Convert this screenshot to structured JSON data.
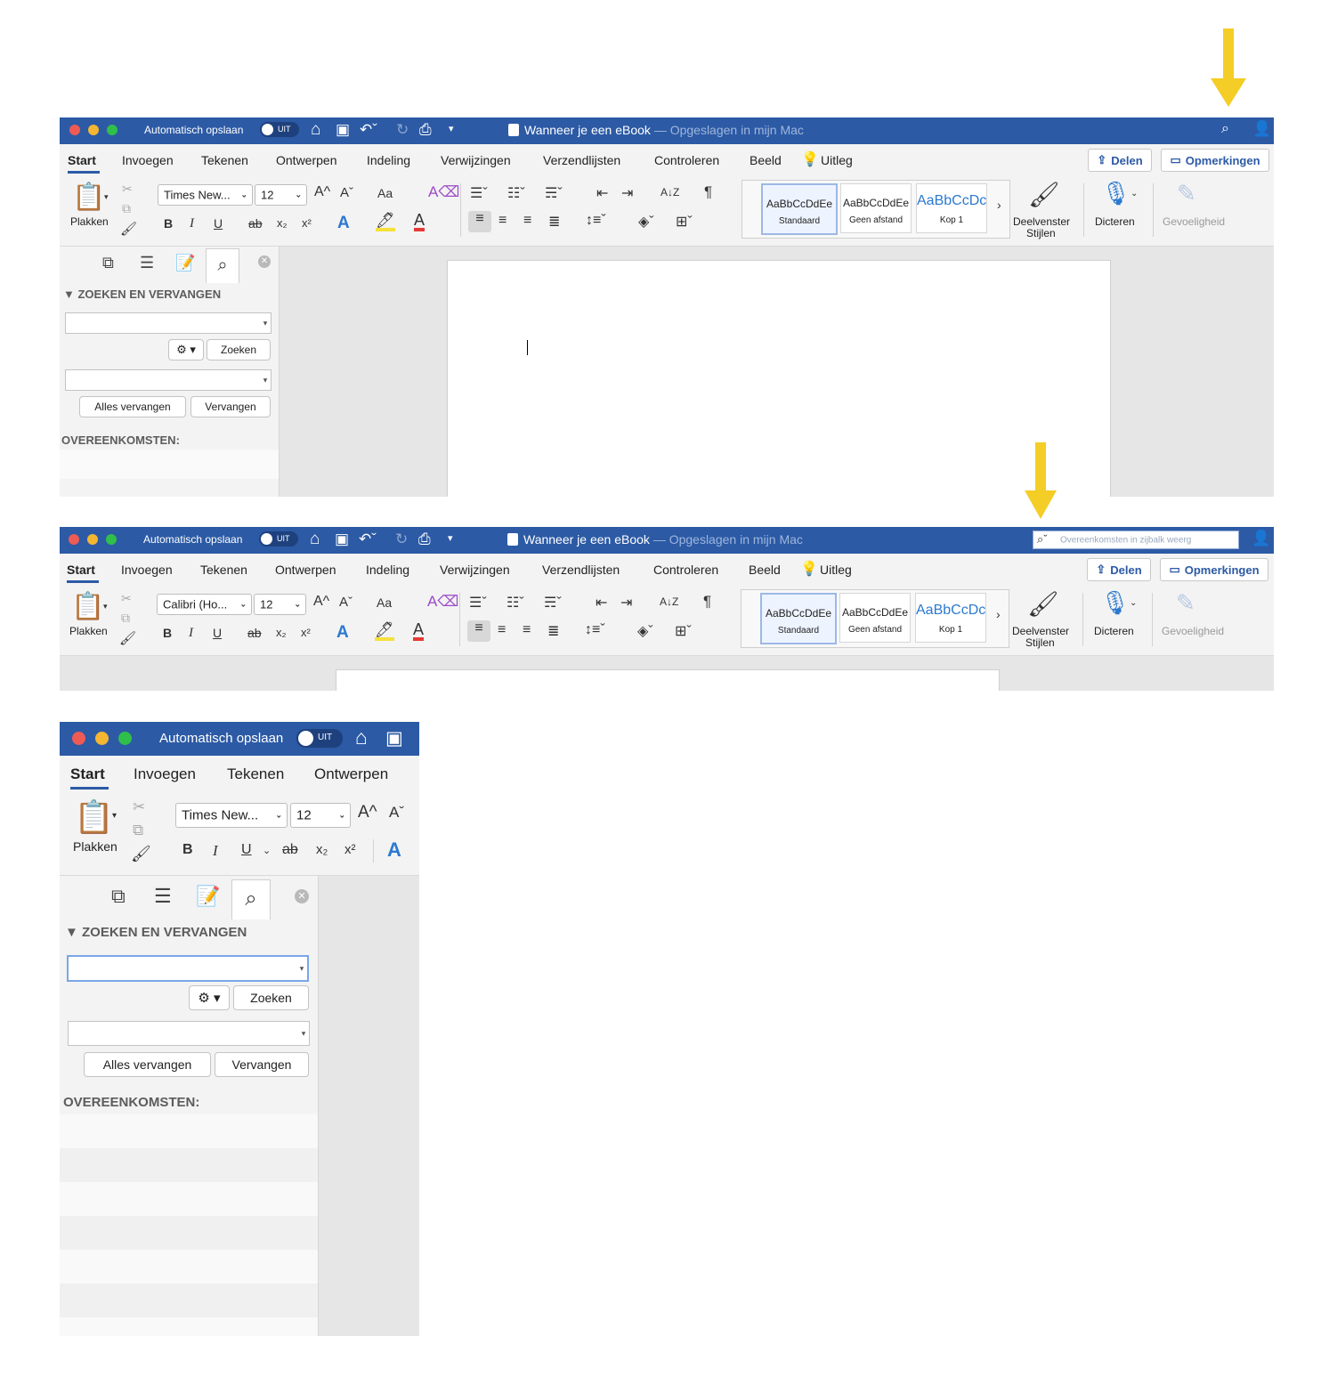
{
  "colors": {
    "titlebar": "#2c5aa5",
    "arrow": "#f4cd26",
    "accent_blue": "#2b79d0"
  },
  "icons": {
    "home": "home-icon",
    "save": "save-icon",
    "undo": "undo-icon",
    "redo": "redo-icon",
    "print": "print-icon",
    "customize": "customize-toolbar-icon",
    "search": "search-icon",
    "share_person": "share-person-icon",
    "lightbulb": "lightbulb-icon",
    "paste": "paste-icon",
    "microphone": "microphone-icon",
    "sensitivity": "sensitivity-icon",
    "styles_pane": "styles-pane-icon",
    "gear": "gear-icon",
    "close": "close-icon",
    "arrow_down": "arrow-down-icon"
  },
  "titlebar": {
    "autosave_label": "Automatisch opslaan",
    "toggle_state": "UIT",
    "doc_name": "Wanneer je een eBook",
    "doc_status": "— Opgeslagen in mijn Mac",
    "search_placeholder": "Overeenkomsten in zijbalk weerg"
  },
  "tabs": [
    "Start",
    "Invoegen",
    "Tekenen",
    "Ontwerpen",
    "Indeling",
    "Verwijzingen",
    "Verzendlijsten",
    "Controleren",
    "Beeld",
    "Uitleg"
  ],
  "share": {
    "delen": "Delen",
    "opmerkingen": "Opmerkingen"
  },
  "ribbon": {
    "plakken": "Plakken",
    "font_name_1": "Times New...",
    "font_name_2": "Calibri (Ho...",
    "font_size": "12",
    "bold": "B",
    "italic": "I",
    "underline": "U",
    "strike": "ab",
    "subscript": "x₂",
    "superscript": "x²",
    "grow": "A^",
    "shrink": "Aˇ",
    "change_case": "Aa",
    "font_color_a": "A",
    "pilcrow": "¶",
    "sort": "A↓Z",
    "styles": [
      {
        "preview": "AaBbCcDdEe",
        "name": "Standaard"
      },
      {
        "preview": "AaBbCcDdEe",
        "name": "Geen afstand"
      },
      {
        "preview": "AaBbCcDc",
        "name": "Kop 1"
      }
    ],
    "more": "›",
    "deelvenster_1": "Deelvenster",
    "deelvenster_2": "Stijlen",
    "dicteren": "Dicteren",
    "gevoeligheid": "Gevoeligheid"
  },
  "find_panel": {
    "header": "ZOEKEN EN VERVANGEN",
    "zoeken": "Zoeken",
    "alles_vervangen": "Alles vervangen",
    "vervangen": "Vervangen",
    "matches": "OVEREENKOMSTEN:"
  }
}
